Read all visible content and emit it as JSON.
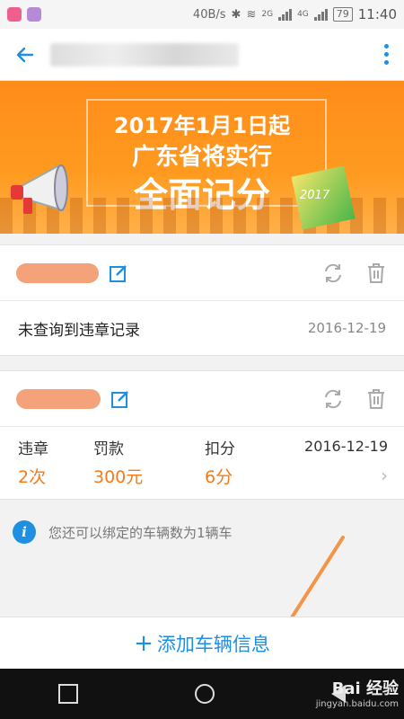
{
  "status_bar": {
    "speed": "40B/s",
    "network_2g": "2G",
    "network_4g": "4G",
    "battery": "79",
    "time": "11:40"
  },
  "banner": {
    "line1": "2017年1月1日起",
    "line2": "广东省将实行",
    "line3": "全面记分",
    "year": "2017"
  },
  "vehicles": [
    {
      "status": "未查询到违章记录",
      "date": "2016-12-19"
    },
    {
      "date": "2016-12-19",
      "violations_label": "违章",
      "violations_value": "2次",
      "fine_label": "罚款",
      "fine_value": "300元",
      "points_label": "扣分",
      "points_value": "6分"
    }
  ],
  "info_text": "您还可以绑定的车辆数为1辆车",
  "add_button": {
    "plus": "+",
    "label": "添加车辆信息"
  },
  "watermark": {
    "logo": "Bai 经验",
    "url": "jingyan.baidu.com"
  },
  "colors": {
    "accent": "#1e8fe1",
    "orange": "#f37b1d",
    "banner": "#ff8c1a"
  }
}
